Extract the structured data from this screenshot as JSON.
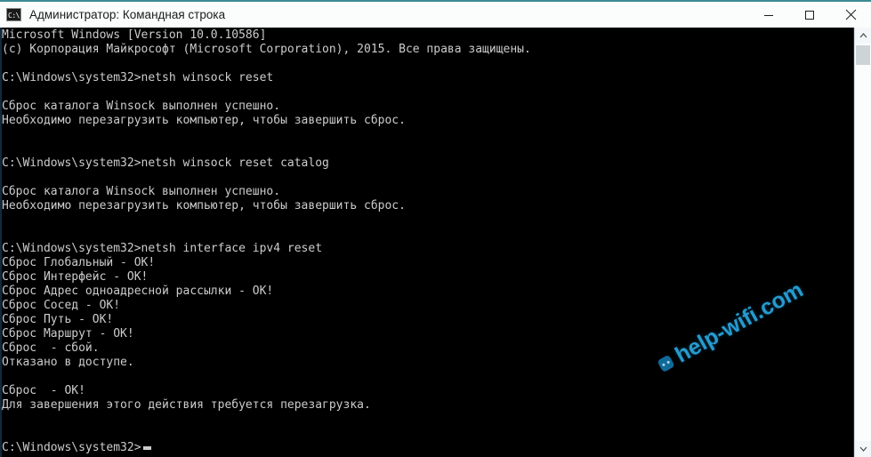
{
  "window": {
    "title": "Администратор: Командная строка",
    "icon_label": "C:\\",
    "icon_name": "command-prompt-icon",
    "controls": {
      "minimize": "minimize-icon",
      "maximize": "maximize-icon",
      "close": "close-icon"
    }
  },
  "console": {
    "prompt_cursor": "block-cursor",
    "lines": [
      "Microsoft Windows [Version 10.0.10586]",
      "(c) Корпорация Майкрософт (Microsoft Corporation), 2015. Все права защищены.",
      "",
      "C:\\Windows\\system32>netsh winsock reset",
      "",
      "Сброс каталога Winsock выполнен успешно.",
      "Необходимо перезагрузить компьютер, чтобы завершить сброс.",
      "",
      "",
      "C:\\Windows\\system32>netsh winsock reset catalog",
      "",
      "Сброс каталога Winsock выполнен успешно.",
      "Необходимо перезагрузить компьютер, чтобы завершить сброс.",
      "",
      "",
      "C:\\Windows\\system32>netsh interface ipv4 reset",
      "Сброс Глобальный - OK!",
      "Сброс Интерфейс - OK!",
      "Сброс Адрес одноадресной рассылки - OK!",
      "Сброс Сосед - OK!",
      "Сброс Путь - OK!",
      "Сброс Маршрут - OK!",
      "Сброс  - сбой.",
      "Отказано в доступе.",
      "",
      "Сброс  - OK!",
      "Для завершения этого действия требуется перезагрузка.",
      "",
      "",
      "C:\\Windows\\system32>"
    ],
    "full_text": "Microsoft Windows [Version 10.0.10586]\n(c) Корпорация Майкрософт (Microsoft Corporation), 2015. Все права защищены.\n\nC:\\Windows\\system32>netsh winsock reset\n\nСброс каталога Winsock выполнен успешно.\nНеобходимо перезагрузить компьютер, чтобы завершить сброс.\n\n\nC:\\Windows\\system32>netsh winsock reset catalog\n\nСброс каталога Winsock выполнен успешно.\nНеобходимо перезагрузить компьютер, чтобы завершить сброс.\n\n\nC:\\Windows\\system32>netsh interface ipv4 reset\nСброс Глобальный - OK!\nСброс Интерфейс - OK!\nСброс Адрес одноадресной рассылки - OK!\nСброс Сосед - OK!\nСброс Путь - OK!\nСброс Маршрут - OK!\nСброс  - сбой.\nОтказано в доступе.\n\nСброс  - OK!\nДля завершения этого действия требуется перезагрузка.\n\n\nC:\\Windows\\system32>"
  },
  "watermark": {
    "text": "help-wifi.com",
    "icon_name": "chat-bubble-icon"
  },
  "scrollbar": {
    "up_arrow": "chevron-up-icon",
    "down_arrow": "chevron-down-icon",
    "thumb": "scrollbar-thumb"
  },
  "colors": {
    "titlebar_accent": "#3b8b94",
    "console_background": "#000000",
    "console_text": "#cccccc",
    "watermark": "#2aa8e0",
    "scrollbar_track": "#f4f7f9",
    "scrollbar_thumb": "#cdd4d8"
  }
}
